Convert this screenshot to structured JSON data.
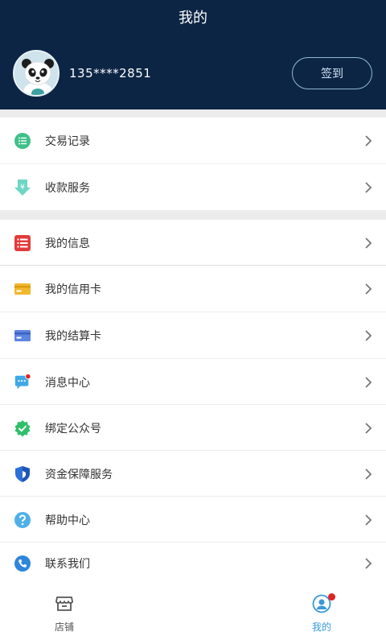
{
  "header": {
    "title": "我的",
    "phone": "135****2851",
    "checkin_label": "签到"
  },
  "menu": {
    "group1": [
      {
        "label": "交易记录",
        "icon": "list-circle-icon"
      },
      {
        "label": "收款服务",
        "icon": "yen-down-arrow-icon"
      }
    ],
    "group2": [
      {
        "label": "我的信息",
        "icon": "info-list-icon"
      },
      {
        "label": "我的信用卡",
        "icon": "credit-card-icon"
      },
      {
        "label": "我的结算卡",
        "icon": "settlement-card-icon"
      },
      {
        "label": "消息中心",
        "icon": "message-icon"
      },
      {
        "label": "绑定公众号",
        "icon": "verified-badge-icon"
      },
      {
        "label": "资金保障服务",
        "icon": "shield-icon"
      },
      {
        "label": "帮助中心",
        "icon": "help-icon"
      },
      {
        "label": "联系我们",
        "icon": "phone-icon"
      }
    ]
  },
  "tabbar": {
    "store_label": "店铺",
    "mine_label": "我的"
  },
  "colors": {
    "header_bg": "#0d2545",
    "active_tab": "#3a9ad9",
    "badge": "#e02424"
  }
}
